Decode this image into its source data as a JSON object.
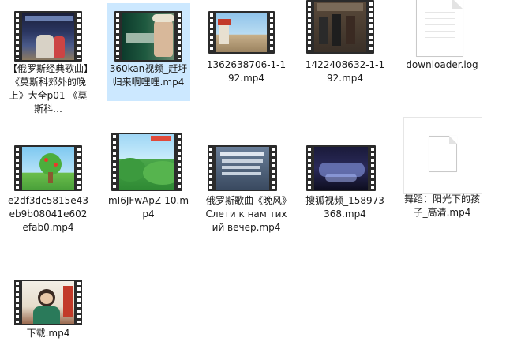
{
  "files": [
    {
      "name": "【俄罗斯经典歌曲】《莫斯科郊外的晚上》大全p01 《莫斯科…",
      "type": "video",
      "icon": "video-thumbnail-icon"
    },
    {
      "name": "360kan视频_赶圩归来啊哩哩.mp4",
      "type": "video",
      "icon": "video-thumbnail-icon"
    },
    {
      "name": "1362638706-1-192.mp4",
      "type": "video",
      "icon": "video-thumbnail-icon"
    },
    {
      "name": "1422408632-1-192.mp4",
      "type": "video",
      "icon": "video-thumbnail-icon"
    },
    {
      "name": "downloader.log",
      "type": "text",
      "icon": "text-document-icon"
    },
    {
      "name": "e2df3dc5815e43eb9b08041e602efab0.mp4",
      "type": "video",
      "icon": "video-thumbnail-icon"
    },
    {
      "name": "mI6JFwApZ-10.mp4",
      "type": "video",
      "icon": "video-thumbnail-icon"
    },
    {
      "name": "俄罗斯歌曲《晚风》Слети к нам тихий вечер.mp4",
      "type": "video",
      "icon": "video-thumbnail-icon"
    },
    {
      "name": "搜狐视频_158973368.mp4",
      "type": "video",
      "icon": "video-thumbnail-icon"
    },
    {
      "name": "舞蹈：阳光下的孩子_高清.mp4",
      "type": "file",
      "icon": "generic-file-icon"
    },
    {
      "name": "下载.mp4",
      "type": "video",
      "icon": "video-thumbnail-icon"
    }
  ],
  "colors": {
    "selection": "#cce8ff",
    "hover": "#e5f3ff",
    "film": "#2b2b2b"
  }
}
